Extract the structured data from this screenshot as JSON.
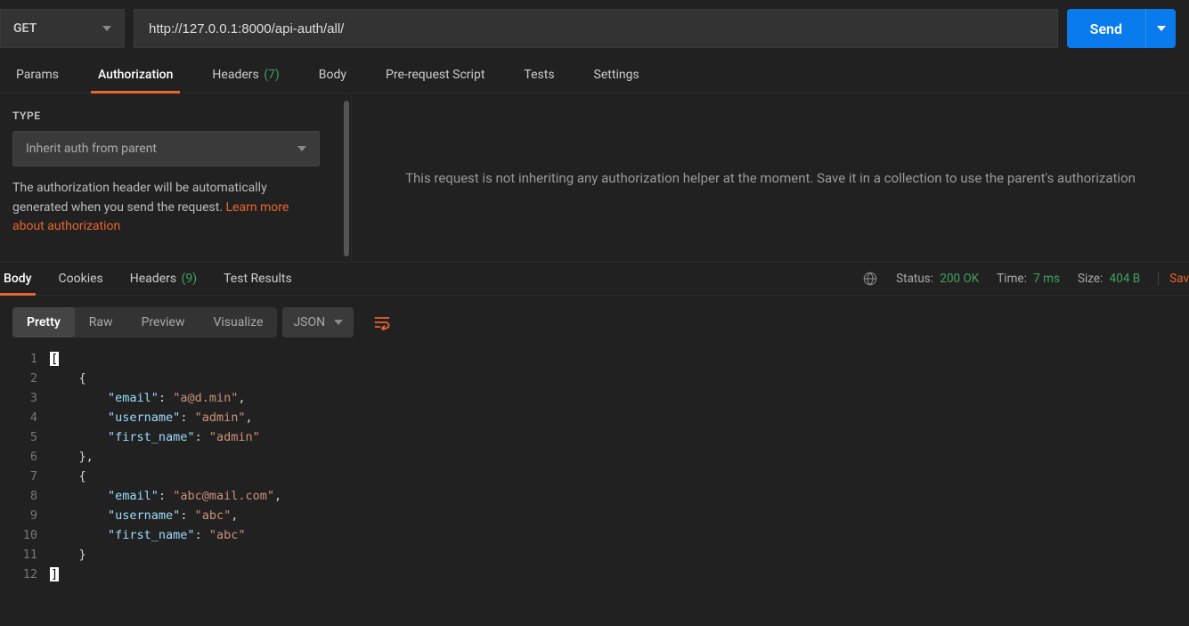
{
  "request": {
    "method": "GET",
    "url": "http://127.0.0.1:8000/api-auth/all/",
    "send_label": "Send"
  },
  "request_tabs": {
    "params_label": "Params",
    "authorization_label": "Authorization",
    "headers_label": "Headers",
    "headers_count": "(7)",
    "body_label": "Body",
    "prerequest_label": "Pre-request Script",
    "tests_label": "Tests",
    "settings_label": "Settings"
  },
  "auth_panel": {
    "type_label": "TYPE",
    "type_value": "Inherit auth from parent",
    "help_text_1": "The authorization header will be automatically generated when you send the request. ",
    "help_link": "Learn more about authorization",
    "right_message": "This request is not inheriting any authorization helper at the moment. Save it in a collection to use the parent's authorization"
  },
  "response_tabs": {
    "body_label": "Body",
    "cookies_label": "Cookies",
    "headers_label": "Headers",
    "headers_count": "(9)",
    "test_results_label": "Test Results"
  },
  "response_meta": {
    "status_label": "Status:",
    "status_value": "200 OK",
    "time_label": "Time:",
    "time_value": "7 ms",
    "size_label": "Size:",
    "size_value": "404 B",
    "save_label": "Sav"
  },
  "body_view": {
    "pretty_label": "Pretty",
    "raw_label": "Raw",
    "preview_label": "Preview",
    "visualize_label": "Visualize",
    "lang_label": "JSON"
  },
  "response_body": [
    {
      "email": "a@d.min",
      "username": "admin",
      "first_name": "admin"
    },
    {
      "email": "abc@mail.com",
      "username": "abc",
      "first_name": "abc"
    }
  ]
}
